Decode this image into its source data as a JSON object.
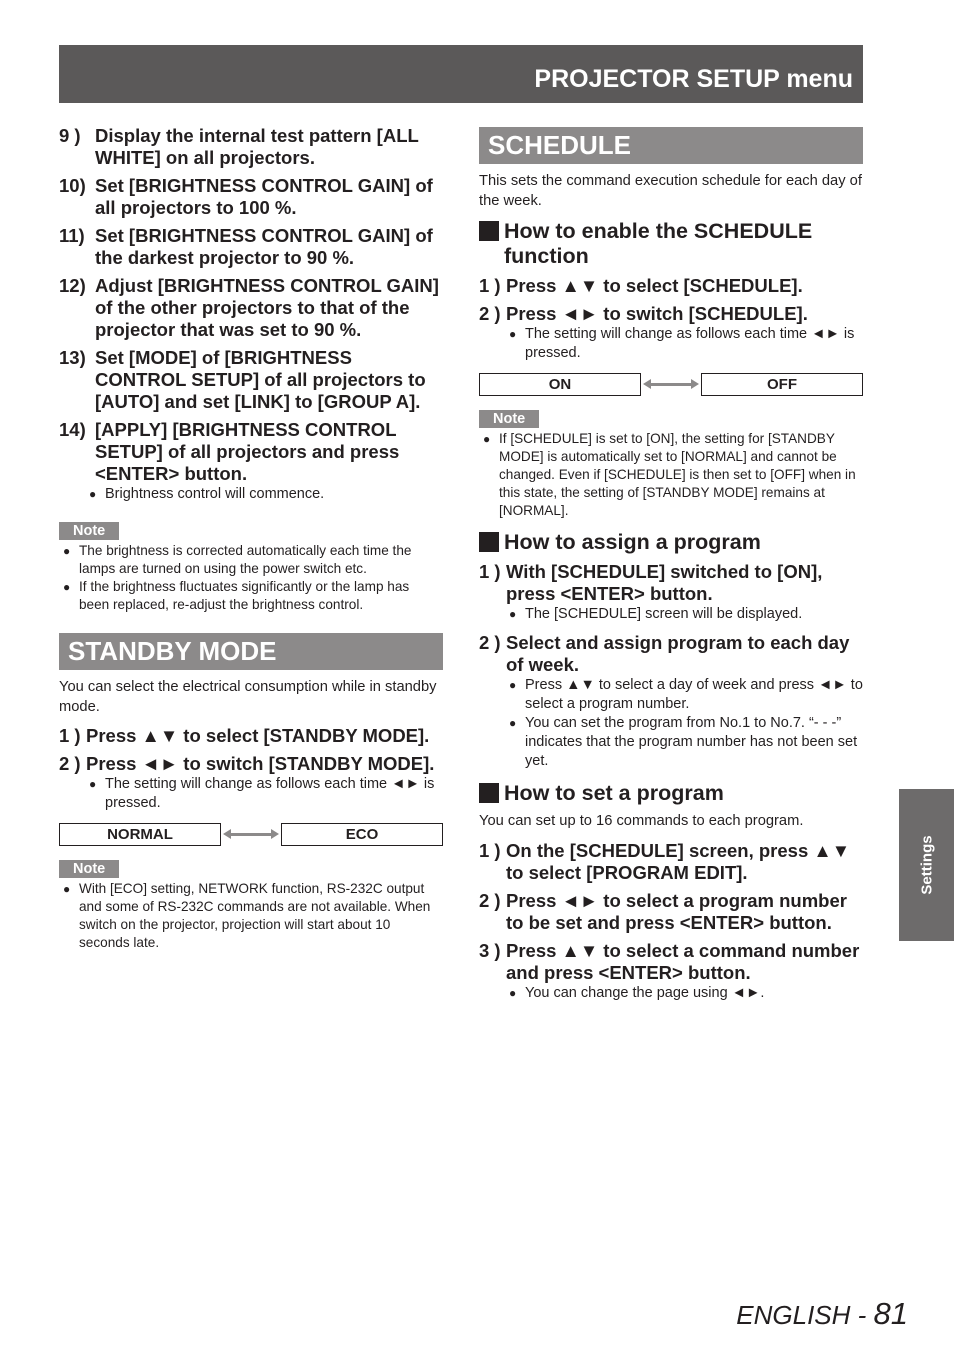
{
  "header": {
    "title": "PROJECTOR SETUP menu"
  },
  "left": {
    "steps": [
      {
        "num": "9 )",
        "text": "Display the internal test pattern [ALL WHITE] on all projectors."
      },
      {
        "num": "10)",
        "text": "Set [BRIGHTNESS CONTROL GAIN] of all projectors to 100 %."
      },
      {
        "num": "11)",
        "text": "Set [BRIGHTNESS CONTROL GAIN] of the darkest projector to 90 %."
      },
      {
        "num": "12)",
        "text": "Adjust [BRIGHTNESS CONTROL GAIN] of the other projectors to that of the projector that was set to 90 %."
      },
      {
        "num": "13)",
        "text": "Set [MODE] of [BRIGHTNESS CONTROL SETUP] of all projectors to [AUTO] and set [LINK] to [GROUP A]."
      },
      {
        "num": "14)",
        "text": "[APPLY] [BRIGHTNESS CONTROL SETUP] of all projectors and press <ENTER> button."
      }
    ],
    "step14_bullet": "Brightness control will commence.",
    "note_label": "Note",
    "notes": [
      "The brightness is corrected automatically each time the lamps are turned on using the power switch etc.",
      "If the brightness fluctuates significantly or the lamp has been replaced, re-adjust the brightness control."
    ],
    "standby": {
      "title": "STANDBY MODE",
      "intro": "You can select the electrical consumption while in standby mode.",
      "steps": [
        {
          "num": "1 )",
          "text": "Press ▲▼ to select [STANDBY MODE]."
        },
        {
          "num": "2 )",
          "text": "Press ◄► to switch [STANDBY MODE]."
        }
      ],
      "bullet": "The setting will change as follows each time ◄► is pressed.",
      "toggle": {
        "left": "NORMAL",
        "right": "ECO"
      },
      "note_label": "Note",
      "notes": [
        "With [ECO] setting, NETWORK function, RS-232C output and some of RS-232C commands are not available. When switch on the projector, projection will start about 10 seconds late."
      ]
    }
  },
  "right": {
    "schedule": {
      "title": "SCHEDULE",
      "intro": "This sets the command execution schedule for each day of the week."
    },
    "enable": {
      "heading": "How to enable the SCHEDULE function",
      "steps": [
        {
          "num": "1 )",
          "text": "Press ▲▼ to select [SCHEDULE]."
        },
        {
          "num": "2 )",
          "text": "Press ◄► to switch [SCHEDULE]."
        }
      ],
      "bullet": "The setting will change as follows each time ◄► is pressed.",
      "toggle": {
        "left": "ON",
        "right": "OFF"
      },
      "note_label": "Note",
      "notes": [
        "If [SCHEDULE] is set to [ON], the setting for [STANDBY MODE] is automatically set to [NORMAL] and cannot be changed. Even if [SCHEDULE] is then set to [OFF] when in this state, the setting of [STANDBY MODE] remains at [NORMAL]."
      ]
    },
    "assign": {
      "heading": "How to assign a program",
      "steps": [
        {
          "num": "1 )",
          "text": "With [SCHEDULE] switched to [ON], press <ENTER> button."
        },
        {
          "num": "2 )",
          "text": "Select and assign program to each day of week."
        }
      ],
      "step1_bullets": [
        "The [SCHEDULE] screen will be displayed."
      ],
      "step2_bullets": [
        "Press ▲▼ to select a day of week and press ◄► to select a program number.",
        "You can set the program from No.1 to No.7. “- - -” indicates that the program number has not been set yet."
      ]
    },
    "setprog": {
      "heading": "How to set a program",
      "intro": "You can set up to 16 commands to each program.",
      "steps": [
        {
          "num": "1 )",
          "text": "On the [SCHEDULE] screen, press ▲▼ to select [PROGRAM EDIT]."
        },
        {
          "num": "2 )",
          "text": "Press ◄► to select a program number to be set and press <ENTER> button."
        },
        {
          "num": "3 )",
          "text": "Press ▲▼ to select a command number and press <ENTER> button."
        }
      ],
      "step3_bullets": [
        "You can change the page using ◄►."
      ]
    }
  },
  "side_tab": {
    "label": "Settings"
  },
  "footer": {
    "language": "ENGLISH - ",
    "page": "81"
  }
}
